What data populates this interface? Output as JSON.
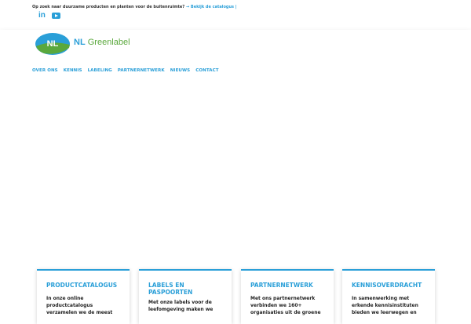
{
  "topbar": {
    "announcement": "Op zoek naar duurzame producten en planten voor de buitenruimte?",
    "link": "→ Bekijk de catalogus",
    "link_suffix": "|",
    "social": {
      "linkedin": "in",
      "youtube_icon": "youtube-icon"
    }
  },
  "header": {
    "logo_text": "NL",
    "brand_nl": "NL",
    "brand_green": "Greenlabel"
  },
  "nav": {
    "items": [
      "OVER ONS",
      "KENNIS",
      "LABELING",
      "PARTNERNETWERK",
      "NIEUWS",
      "CONTACT"
    ]
  },
  "cards": [
    {
      "title": "PRODUCTCATALOGUS",
      "text": "In onze online productcatalogus verzamelen we de meest"
    },
    {
      "title": "LABELS EN PASPOORTEN",
      "text": "Met onze labels voor de leefomgeving maken we"
    },
    {
      "title": "PARTNERNETWERK",
      "text": "Met ons partnernetwerk verbinden we 160+ organisaties uit de groene"
    },
    {
      "title": "KENNISOVERDRACHT",
      "text": "In samenwerking met erkende kennisinstituten bieden we leerwegen en"
    }
  ],
  "colors": {
    "accent": "#2a9fd8",
    "green": "#5aa83c"
  }
}
